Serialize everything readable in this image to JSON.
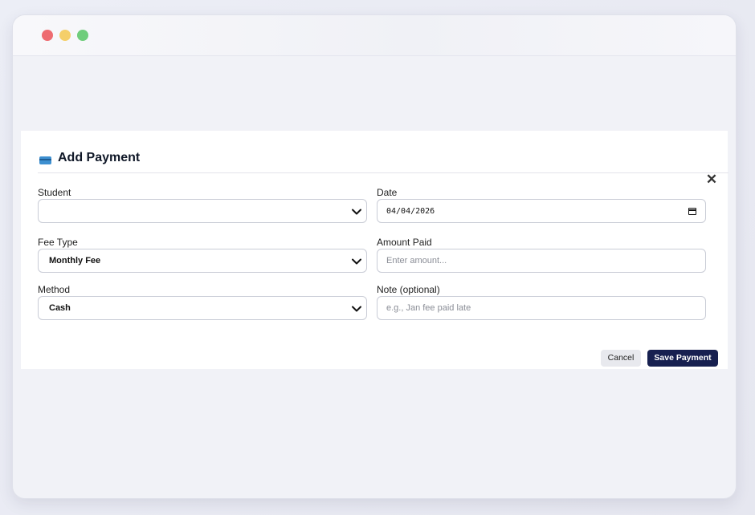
{
  "window": {
    "controls": [
      "close",
      "minimize",
      "maximize"
    ]
  },
  "modal": {
    "title": "Add Payment",
    "icon": "credit-card-icon",
    "close_icon": "close-icon"
  },
  "form": {
    "student": {
      "label": "Student",
      "value": ""
    },
    "date": {
      "label": "Date",
      "value": "04/04/2026"
    },
    "fee_type": {
      "label": "Fee Type",
      "value": "Monthly Fee"
    },
    "amount": {
      "label": "Amount Paid",
      "placeholder": "Enter amount..."
    },
    "method": {
      "label": "Method",
      "value": "Cash"
    },
    "note": {
      "label": "Note (optional)",
      "placeholder": "e.g., Jan fee paid late"
    }
  },
  "actions": {
    "cancel_label": "Cancel",
    "save_label": "Save Payment"
  },
  "colors": {
    "primary_button": "#172050",
    "accent_icon": "#3d8fd0"
  }
}
